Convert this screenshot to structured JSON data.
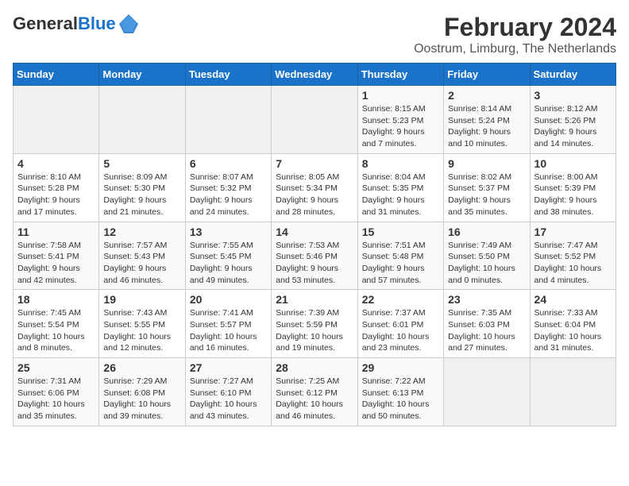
{
  "logo": {
    "general": "General",
    "blue": "Blue"
  },
  "header": {
    "title": "February 2024",
    "subtitle": "Oostrum, Limburg, The Netherlands"
  },
  "weekdays": [
    "Sunday",
    "Monday",
    "Tuesday",
    "Wednesday",
    "Thursday",
    "Friday",
    "Saturday"
  ],
  "weeks": [
    [
      {
        "day": "",
        "info": ""
      },
      {
        "day": "",
        "info": ""
      },
      {
        "day": "",
        "info": ""
      },
      {
        "day": "",
        "info": ""
      },
      {
        "day": "1",
        "info": "Sunrise: 8:15 AM\nSunset: 5:23 PM\nDaylight: 9 hours\nand 7 minutes."
      },
      {
        "day": "2",
        "info": "Sunrise: 8:14 AM\nSunset: 5:24 PM\nDaylight: 9 hours\nand 10 minutes."
      },
      {
        "day": "3",
        "info": "Sunrise: 8:12 AM\nSunset: 5:26 PM\nDaylight: 9 hours\nand 14 minutes."
      }
    ],
    [
      {
        "day": "4",
        "info": "Sunrise: 8:10 AM\nSunset: 5:28 PM\nDaylight: 9 hours\nand 17 minutes."
      },
      {
        "day": "5",
        "info": "Sunrise: 8:09 AM\nSunset: 5:30 PM\nDaylight: 9 hours\nand 21 minutes."
      },
      {
        "day": "6",
        "info": "Sunrise: 8:07 AM\nSunset: 5:32 PM\nDaylight: 9 hours\nand 24 minutes."
      },
      {
        "day": "7",
        "info": "Sunrise: 8:05 AM\nSunset: 5:34 PM\nDaylight: 9 hours\nand 28 minutes."
      },
      {
        "day": "8",
        "info": "Sunrise: 8:04 AM\nSunset: 5:35 PM\nDaylight: 9 hours\nand 31 minutes."
      },
      {
        "day": "9",
        "info": "Sunrise: 8:02 AM\nSunset: 5:37 PM\nDaylight: 9 hours\nand 35 minutes."
      },
      {
        "day": "10",
        "info": "Sunrise: 8:00 AM\nSunset: 5:39 PM\nDaylight: 9 hours\nand 38 minutes."
      }
    ],
    [
      {
        "day": "11",
        "info": "Sunrise: 7:58 AM\nSunset: 5:41 PM\nDaylight: 9 hours\nand 42 minutes."
      },
      {
        "day": "12",
        "info": "Sunrise: 7:57 AM\nSunset: 5:43 PM\nDaylight: 9 hours\nand 46 minutes."
      },
      {
        "day": "13",
        "info": "Sunrise: 7:55 AM\nSunset: 5:45 PM\nDaylight: 9 hours\nand 49 minutes."
      },
      {
        "day": "14",
        "info": "Sunrise: 7:53 AM\nSunset: 5:46 PM\nDaylight: 9 hours\nand 53 minutes."
      },
      {
        "day": "15",
        "info": "Sunrise: 7:51 AM\nSunset: 5:48 PM\nDaylight: 9 hours\nand 57 minutes."
      },
      {
        "day": "16",
        "info": "Sunrise: 7:49 AM\nSunset: 5:50 PM\nDaylight: 10 hours\nand 0 minutes."
      },
      {
        "day": "17",
        "info": "Sunrise: 7:47 AM\nSunset: 5:52 PM\nDaylight: 10 hours\nand 4 minutes."
      }
    ],
    [
      {
        "day": "18",
        "info": "Sunrise: 7:45 AM\nSunset: 5:54 PM\nDaylight: 10 hours\nand 8 minutes."
      },
      {
        "day": "19",
        "info": "Sunrise: 7:43 AM\nSunset: 5:55 PM\nDaylight: 10 hours\nand 12 minutes."
      },
      {
        "day": "20",
        "info": "Sunrise: 7:41 AM\nSunset: 5:57 PM\nDaylight: 10 hours\nand 16 minutes."
      },
      {
        "day": "21",
        "info": "Sunrise: 7:39 AM\nSunset: 5:59 PM\nDaylight: 10 hours\nand 19 minutes."
      },
      {
        "day": "22",
        "info": "Sunrise: 7:37 AM\nSunset: 6:01 PM\nDaylight: 10 hours\nand 23 minutes."
      },
      {
        "day": "23",
        "info": "Sunrise: 7:35 AM\nSunset: 6:03 PM\nDaylight: 10 hours\nand 27 minutes."
      },
      {
        "day": "24",
        "info": "Sunrise: 7:33 AM\nSunset: 6:04 PM\nDaylight: 10 hours\nand 31 minutes."
      }
    ],
    [
      {
        "day": "25",
        "info": "Sunrise: 7:31 AM\nSunset: 6:06 PM\nDaylight: 10 hours\nand 35 minutes."
      },
      {
        "day": "26",
        "info": "Sunrise: 7:29 AM\nSunset: 6:08 PM\nDaylight: 10 hours\nand 39 minutes."
      },
      {
        "day": "27",
        "info": "Sunrise: 7:27 AM\nSunset: 6:10 PM\nDaylight: 10 hours\nand 43 minutes."
      },
      {
        "day": "28",
        "info": "Sunrise: 7:25 AM\nSunset: 6:12 PM\nDaylight: 10 hours\nand 46 minutes."
      },
      {
        "day": "29",
        "info": "Sunrise: 7:22 AM\nSunset: 6:13 PM\nDaylight: 10 hours\nand 50 minutes."
      },
      {
        "day": "",
        "info": ""
      },
      {
        "day": "",
        "info": ""
      }
    ]
  ]
}
